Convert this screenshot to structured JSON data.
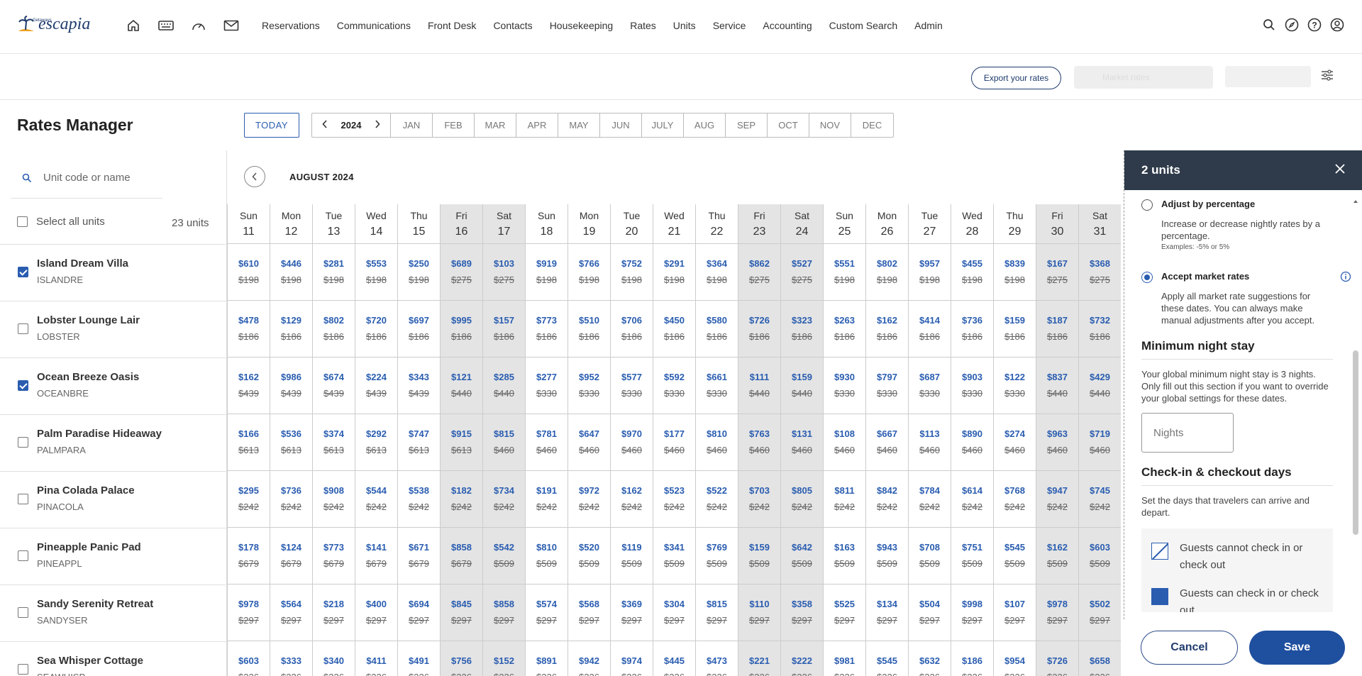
{
  "nav": {
    "logo_text": "escapia",
    "logo_sub": "Getaways",
    "links": [
      "Reservations",
      "Communications",
      "Front Desk",
      "Contacts",
      "Housekeeping",
      "Rates",
      "Units",
      "Service",
      "Accounting",
      "Custom Search",
      "Admin"
    ]
  },
  "toolbar": {
    "export_label": "Export your rates",
    "market_label": "Market rates"
  },
  "page": {
    "title": "Rates Manager",
    "today_label": "TODAY",
    "year": "2024",
    "months": [
      "JAN",
      "FEB",
      "MAR",
      "APR",
      "MAY",
      "JUN",
      "JULY",
      "AUG",
      "SEP",
      "OCT",
      "NOV",
      "DEC"
    ]
  },
  "units_panel": {
    "search_placeholder": "Unit code or name",
    "select_all_label": "Select all units",
    "count_label": "23 units",
    "units": [
      {
        "name": "Island Dream Villa",
        "code": "ISLANDRE",
        "checked": true
      },
      {
        "name": "Lobster Lounge Lair",
        "code": "LOBSTER",
        "checked": false
      },
      {
        "name": "Ocean Breeze Oasis",
        "code": "OCEANBRE",
        "checked": true
      },
      {
        "name": "Palm Paradise Hideaway",
        "code": "PALMPARA",
        "checked": false
      },
      {
        "name": "Pina Colada Palace",
        "code": "PINACOLA",
        "checked": false
      },
      {
        "name": "Pineapple Panic Pad",
        "code": "PINEAPPL",
        "checked": false
      },
      {
        "name": "Sandy Serenity Retreat",
        "code": "SANDYSER",
        "checked": false
      },
      {
        "name": "Sea Whisper Cottage",
        "code": "SEAWHISP",
        "checked": false
      }
    ]
  },
  "calendar": {
    "month_title": "AUGUST 2024",
    "days": [
      {
        "name": "Sun",
        "num": "11",
        "weekend": false
      },
      {
        "name": "Mon",
        "num": "12",
        "weekend": false
      },
      {
        "name": "Tue",
        "num": "13",
        "weekend": false
      },
      {
        "name": "Wed",
        "num": "14",
        "weekend": false
      },
      {
        "name": "Thu",
        "num": "15",
        "weekend": false
      },
      {
        "name": "Fri",
        "num": "16",
        "weekend": true
      },
      {
        "name": "Sat",
        "num": "17",
        "weekend": true
      },
      {
        "name": "Sun",
        "num": "18",
        "weekend": false
      },
      {
        "name": "Mon",
        "num": "19",
        "weekend": false
      },
      {
        "name": "Tue",
        "num": "20",
        "weekend": false
      },
      {
        "name": "Wed",
        "num": "21",
        "weekend": false
      },
      {
        "name": "Thu",
        "num": "22",
        "weekend": false
      },
      {
        "name": "Fri",
        "num": "23",
        "weekend": true
      },
      {
        "name": "Sat",
        "num": "24",
        "weekend": true
      },
      {
        "name": "Sun",
        "num": "25",
        "weekend": false
      },
      {
        "name": "Mon",
        "num": "26",
        "weekend": false
      },
      {
        "name": "Tue",
        "num": "27",
        "weekend": false
      },
      {
        "name": "Wed",
        "num": "28",
        "weekend": false
      },
      {
        "name": "Thu",
        "num": "29",
        "weekend": false
      },
      {
        "name": "Fri",
        "num": "30",
        "weekend": true
      },
      {
        "name": "Sat",
        "num": "31",
        "weekend": true
      }
    ],
    "rates": [
      {
        "new": [
          "$610",
          "$446",
          "$281",
          "$553",
          "$250",
          "$689",
          "$103",
          "$919",
          "$766",
          "$752",
          "$291",
          "$364",
          "$862",
          "$527",
          "$551",
          "$802",
          "$957",
          "$455",
          "$839",
          "$167",
          "$368"
        ],
        "old": [
          "$198",
          "$198",
          "$198",
          "$198",
          "$198",
          "$275",
          "$275",
          "$198",
          "$198",
          "$198",
          "$198",
          "$198",
          "$275",
          "$275",
          "$198",
          "$198",
          "$198",
          "$198",
          "$198",
          "$275",
          "$275"
        ]
      },
      {
        "new": [
          "$478",
          "$129",
          "$802",
          "$720",
          "$697",
          "$995",
          "$157",
          "$773",
          "$510",
          "$706",
          "$450",
          "$580",
          "$726",
          "$323",
          "$263",
          "$162",
          "$414",
          "$736",
          "$159",
          "$187",
          "$732"
        ],
        "old": [
          "$186",
          "$186",
          "$186",
          "$186",
          "$186",
          "$186",
          "$186",
          "$186",
          "$186",
          "$186",
          "$186",
          "$186",
          "$186",
          "$186",
          "$186",
          "$186",
          "$186",
          "$186",
          "$186",
          "$186",
          "$186"
        ]
      },
      {
        "new": [
          "$162",
          "$986",
          "$674",
          "$224",
          "$343",
          "$121",
          "$285",
          "$277",
          "$952",
          "$577",
          "$592",
          "$661",
          "$111",
          "$159",
          "$930",
          "$797",
          "$687",
          "$903",
          "$122",
          "$837",
          "$429"
        ],
        "old": [
          "$439",
          "$439",
          "$439",
          "$439",
          "$439",
          "$440",
          "$440",
          "$330",
          "$330",
          "$330",
          "$330",
          "$330",
          "$440",
          "$440",
          "$330",
          "$330",
          "$330",
          "$330",
          "$330",
          "$440",
          "$440"
        ]
      },
      {
        "new": [
          "$166",
          "$536",
          "$374",
          "$292",
          "$747",
          "$915",
          "$815",
          "$781",
          "$647",
          "$970",
          "$177",
          "$810",
          "$763",
          "$131",
          "$108",
          "$667",
          "$113",
          "$890",
          "$274",
          "$963",
          "$719"
        ],
        "old": [
          "$613",
          "$613",
          "$613",
          "$613",
          "$613",
          "$613",
          "$460",
          "$460",
          "$460",
          "$460",
          "$460",
          "$460",
          "$460",
          "$460",
          "$460",
          "$460",
          "$460",
          "$460",
          "$460",
          "$460",
          "$460"
        ]
      },
      {
        "new": [
          "$295",
          "$736",
          "$908",
          "$544",
          "$538",
          "$182",
          "$734",
          "$191",
          "$972",
          "$162",
          "$523",
          "$522",
          "$703",
          "$805",
          "$811",
          "$842",
          "$784",
          "$614",
          "$768",
          "$947",
          "$745"
        ],
        "old": [
          "$242",
          "$242",
          "$242",
          "$242",
          "$242",
          "$242",
          "$242",
          "$242",
          "$242",
          "$242",
          "$242",
          "$242",
          "$242",
          "$242",
          "$242",
          "$242",
          "$242",
          "$242",
          "$242",
          "$242",
          "$242"
        ]
      },
      {
        "new": [
          "$178",
          "$124",
          "$773",
          "$141",
          "$671",
          "$858",
          "$542",
          "$810",
          "$520",
          "$119",
          "$341",
          "$769",
          "$159",
          "$642",
          "$163",
          "$943",
          "$708",
          "$751",
          "$545",
          "$162",
          "$603"
        ],
        "old": [
          "$679",
          "$679",
          "$679",
          "$679",
          "$679",
          "$679",
          "$509",
          "$509",
          "$509",
          "$509",
          "$509",
          "$509",
          "$509",
          "$509",
          "$509",
          "$509",
          "$509",
          "$509",
          "$509",
          "$509",
          "$509"
        ]
      },
      {
        "new": [
          "$978",
          "$564",
          "$218",
          "$400",
          "$694",
          "$845",
          "$858",
          "$574",
          "$568",
          "$369",
          "$304",
          "$815",
          "$110",
          "$358",
          "$525",
          "$134",
          "$504",
          "$998",
          "$107",
          "$978",
          "$502"
        ],
        "old": [
          "$297",
          "$297",
          "$297",
          "$297",
          "$297",
          "$297",
          "$297",
          "$297",
          "$297",
          "$297",
          "$297",
          "$297",
          "$297",
          "$297",
          "$297",
          "$297",
          "$297",
          "$297",
          "$297",
          "$297",
          "$297"
        ]
      },
      {
        "new": [
          "$603",
          "$333",
          "$340",
          "$411",
          "$491",
          "$756",
          "$152",
          "$891",
          "$942",
          "$974",
          "$445",
          "$473",
          "$221",
          "$222",
          "$981",
          "$545",
          "$632",
          "$186",
          "$954",
          "$726",
          "$658"
        ],
        "old": [
          "$226",
          "$226",
          "$226",
          "$226",
          "$226",
          "$226",
          "$226",
          "$226",
          "$226",
          "$226",
          "$226",
          "$226",
          "$226",
          "$226",
          "$226",
          "$226",
          "$226",
          "$226",
          "$226",
          "$226",
          "$226"
        ]
      }
    ]
  },
  "drawer": {
    "title": "2 units",
    "adjust_title": "Adjust by percentage",
    "adjust_desc": "Increase or decrease nightly rates by a percentage.",
    "adjust_example": "Examples: -5% or 5%",
    "accept_title": "Accept market rates",
    "accept_desc": "Apply all market rate suggestions for these dates. You can always make manual adjustments after you accept.",
    "min_title": "Minimum night stay",
    "min_desc": "Your global minimum night stay is 3 nights. Only fill out this section if you want to override your global settings for these dates.",
    "nights_placeholder": "Nights",
    "checkin_title": "Check-in & checkout days",
    "checkin_desc": "Set the days that travelers can arrive and depart.",
    "legend_cannot": "Guests cannot check in or check out",
    "legend_can": "Guests can check in or check out",
    "cancel_label": "Cancel",
    "save_label": "Save"
  },
  "colors": {
    "accent": "#2a5db0",
    "header_dark": "#2f3b4a",
    "weekend": "#e4e4e4"
  }
}
